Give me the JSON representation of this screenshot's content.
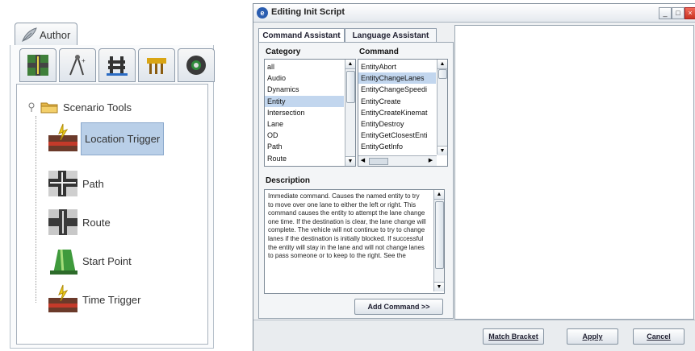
{
  "author_panel": {
    "tab_label": "Author",
    "tool_tabs": [
      {
        "name": "road-tile-icon"
      },
      {
        "name": "compass-icon"
      },
      {
        "name": "barrier-icon"
      },
      {
        "name": "sign-icon"
      },
      {
        "name": "tire-icon"
      }
    ],
    "tree_root_label": "Scenario Tools",
    "tree_items": [
      {
        "label": "Location Trigger",
        "icon": "location-trigger-icon",
        "selected": true
      },
      {
        "label": "Path",
        "icon": "path-icon"
      },
      {
        "label": "Route",
        "icon": "route-icon"
      },
      {
        "label": "Start Point",
        "icon": "start-point-icon"
      },
      {
        "label": "Time Trigger",
        "icon": "time-trigger-icon"
      }
    ]
  },
  "dialog": {
    "title": "Editing Init Script",
    "tabs": {
      "command_assistant": "Command Assistant",
      "language_assistant": "Language Assistant"
    },
    "category_header": "Category",
    "command_header": "Command",
    "categories": [
      "all",
      "Audio",
      "Dynamics",
      "Entity",
      "Intersection",
      "Lane",
      "OD",
      "Path",
      "Route"
    ],
    "selected_category": "Entity",
    "commands": [
      "EntityAbort",
      "EntityChangeLanes",
      "EntityChangeSpeedi",
      "EntityCreate",
      "EntityCreateKinemat",
      "EntityDestroy",
      "EntityGetClosestEnti",
      "EntityGetInfo"
    ],
    "selected_command": "EntityChangeLanes",
    "description_header": "Description",
    "description": "Immediate command. Causes the named entity to try to move over one lane to either the left or right. This command causes the entity to attempt the lane change one time. If the destination is clear, the lane change will complete. The vehicle will not continue to try to change lanes if the destination is initially blocked. If successful the entity will stay in the lane and will not change lanes to pass someone or to keep to the right. See the",
    "add_command_label": "Add Command >>",
    "buttons": {
      "match_bracket": "Match Bracket",
      "apply": "Apply",
      "cancel": "Cancel"
    }
  },
  "colors": {
    "selection": "#c2d6ee",
    "title_icon": "#2a5db0",
    "close_button": "#d9412e"
  }
}
